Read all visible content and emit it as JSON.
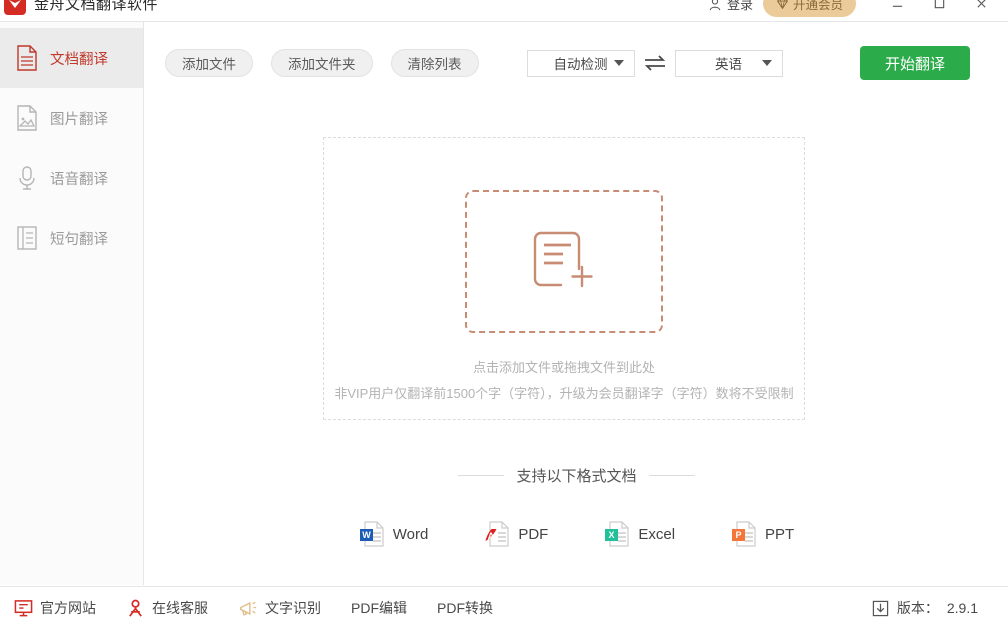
{
  "window": {
    "app_title": "金舟文档翻译软件",
    "login_label": "登录",
    "vip_label": "开通会员",
    "minimize_label": "最小化",
    "maximize_label": "最大化",
    "close_label": "关闭"
  },
  "sidebar": {
    "items": [
      {
        "label": "文档翻译",
        "icon": "document-icon",
        "active": true
      },
      {
        "label": "图片翻译",
        "icon": "image-icon",
        "active": false
      },
      {
        "label": "语音翻译",
        "icon": "microphone-icon",
        "active": false
      },
      {
        "label": "短句翻译",
        "icon": "text-lines-icon",
        "active": false
      }
    ]
  },
  "toolbar": {
    "add_file_label": "添加文件",
    "add_folder_label": "添加文件夹",
    "clear_list_label": "清除列表",
    "source_language": "自动检测",
    "target_language": "英语",
    "swap_icon": "swap-horizontal-icon",
    "translate_label": "开始翻译"
  },
  "dropzone": {
    "icon": "document-plus-icon",
    "hint_primary": "点击添加文件或拖拽文件到此处",
    "hint_secondary": "非VIP用户仅翻译前1500个字（字符），升级为会员翻译字（字符）数将不受限制"
  },
  "formats": {
    "heading": "支持以下格式文档",
    "items": [
      {
        "name": "Word",
        "badge": "W",
        "color": "#1b5cb8"
      },
      {
        "name": "PDF",
        "badge": "A",
        "color": "#e02020"
      },
      {
        "name": "Excel",
        "badge": "X",
        "color": "#21bf9a"
      },
      {
        "name": "PPT",
        "badge": "P",
        "color": "#f5763b"
      }
    ]
  },
  "statusbar": {
    "items": [
      {
        "label": "官方网站",
        "icon": "monitor-icon"
      },
      {
        "label": "在线客服",
        "icon": "person-icon"
      },
      {
        "label": "文字识别",
        "icon": "megaphone-icon"
      },
      {
        "label": "PDF编辑",
        "icon": "none"
      },
      {
        "label": "PDF转换",
        "icon": "none"
      }
    ],
    "version_label": "版本：",
    "version_value": "2.9.1",
    "version_icon": "download-icon"
  },
  "colors": {
    "accent_red": "#c0392b",
    "accent_green": "#2cab4a",
    "accent_gold": "#eccb9a",
    "dropzone_salmon": "#c88b74"
  }
}
